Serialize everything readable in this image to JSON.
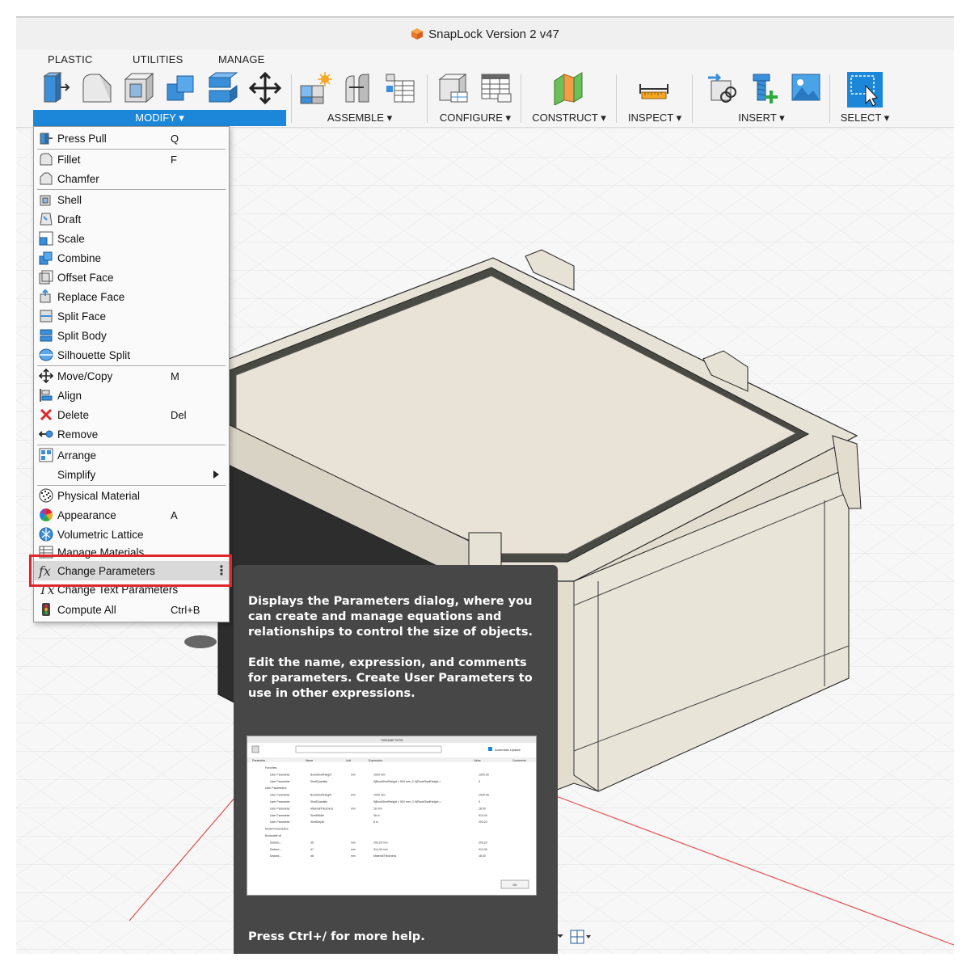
{
  "window": {
    "title": "SnapLock Version 2 v47"
  },
  "tabs": [
    "PLASTIC",
    "UTILITIES",
    "MANAGE"
  ],
  "toolbar": {
    "modify_label": "MODIFY ▾",
    "assemble_label": "ASSEMBLE ▾",
    "configure_label": "CONFIGURE ▾",
    "construct_label": "CONSTRUCT ▾",
    "inspect_label": "INSPECT ▾",
    "insert_label": "INSERT ▾",
    "select_label": "SELECT ▾"
  },
  "menu": {
    "items": [
      {
        "label": "Press Pull",
        "key": "Q",
        "icon": "press-pull-icon"
      },
      {
        "label": "Fillet",
        "key": "F",
        "icon": "fillet-icon"
      },
      {
        "label": "Chamfer",
        "key": "",
        "icon": "chamfer-icon"
      },
      {
        "label": "Shell",
        "key": "",
        "icon": "shell-icon"
      },
      {
        "label": "Draft",
        "key": "",
        "icon": "draft-icon"
      },
      {
        "label": "Scale",
        "key": "",
        "icon": "scale-icon"
      },
      {
        "label": "Combine",
        "key": "",
        "icon": "combine-icon"
      },
      {
        "label": "Offset Face",
        "key": "",
        "icon": "offset-face-icon"
      },
      {
        "label": "Replace Face",
        "key": "",
        "icon": "replace-face-icon"
      },
      {
        "label": "Split Face",
        "key": "",
        "icon": "split-face-icon"
      },
      {
        "label": "Split Body",
        "key": "",
        "icon": "split-body-icon"
      },
      {
        "label": "Silhouette Split",
        "key": "",
        "icon": "silhouette-split-icon"
      },
      {
        "label": "Move/Copy",
        "key": "M",
        "icon": "move-copy-icon"
      },
      {
        "label": "Align",
        "key": "",
        "icon": "align-icon"
      },
      {
        "label": "Delete",
        "key": "Del",
        "icon": "delete-icon"
      },
      {
        "label": "Remove",
        "key": "",
        "icon": "remove-icon"
      },
      {
        "label": "Arrange",
        "key": "",
        "icon": "arrange-icon"
      },
      {
        "label": "Simplify",
        "key": "",
        "icon": ""
      },
      {
        "label": "Physical Material",
        "key": "",
        "icon": "physical-material-icon"
      },
      {
        "label": "Appearance",
        "key": "A",
        "icon": "appearance-icon"
      },
      {
        "label": "Volumetric Lattice",
        "key": "",
        "icon": "volumetric-lattice-icon"
      },
      {
        "label": "Manage Materials",
        "key": "",
        "icon": "manage-materials-icon"
      },
      {
        "label": "Change Parameters",
        "key": "",
        "icon": "change-parameters-icon"
      },
      {
        "label": "Change Text Parameters",
        "key": "",
        "icon": "change-text-parameters-icon"
      },
      {
        "label": "Compute All",
        "key": "Ctrl+B",
        "icon": "compute-all-icon"
      }
    ],
    "more_glyph": "⋮"
  },
  "tooltip": {
    "para1": "Displays the Parameters dialog, where you can create and manage equations and relationships to control the size of objects.",
    "para2": "Edit the name, expression, and comments for parameters. Create User Parameters to use in other expressions.",
    "help": "Press Ctrl+/ for more help.",
    "thumbnail": {
      "title": "PARAMETERS",
      "auto_update": "Automatic Update",
      "headers": [
        "Parameter",
        "Name",
        "Unit",
        "Expression",
        "Value",
        "Comments"
      ],
      "rows": [
        [
          "Favorites",
          "",
          "",
          "",
          ""
        ],
        [
          "User Parameter",
          "BookShelfHeight",
          "mm",
          "1000 mm",
          "1000.00"
        ],
        [
          "User Parameter",
          "ShelfQuantity",
          "",
          "if(BookShelfHeight > 500 mm; 2; if(BookShelfHeight >",
          "3"
        ],
        [
          "User Parameters",
          "",
          "",
          "",
          ""
        ],
        [
          "User Parameter",
          "BookShelfHeight",
          "mm",
          "1000 mm",
          "1000.00"
        ],
        [
          "User Parameter",
          "ShelfQuantity",
          "",
          "if(BookShelfHeight > 500 mm; 2; if(BookShelfHeight >",
          "3"
        ],
        [
          "User Parameter",
          "MaterialThickness",
          "mm",
          "18 mm",
          "18.00"
        ],
        [
          "User Parameter",
          "ShelfWidth",
          "",
          "36 in",
          "914.40"
        ],
        [
          "User Parameter",
          "ShelfDepth",
          "",
          "8 in",
          "203.20"
        ],
        [
          "Model Parameters",
          "",
          "",
          "",
          ""
        ],
        [
          "Bookshelf v8",
          "",
          "",
          "",
          ""
        ],
        [
          "Distanc...",
          "d6",
          "mm",
          "203.20 mm",
          "203.20"
        ],
        [
          "Distanc...",
          "d7",
          "mm",
          "914.40 mm",
          "914.40"
        ],
        [
          "Distanc...",
          "d8",
          "mm",
          "MaterialThickness",
          "18.00"
        ]
      ],
      "ok": "OK"
    }
  },
  "colors": {
    "accent": "#1c87d9",
    "highlight_box": "#e0262b",
    "tooltip_bg": "#474747",
    "model_body": "#e8e4d8"
  }
}
